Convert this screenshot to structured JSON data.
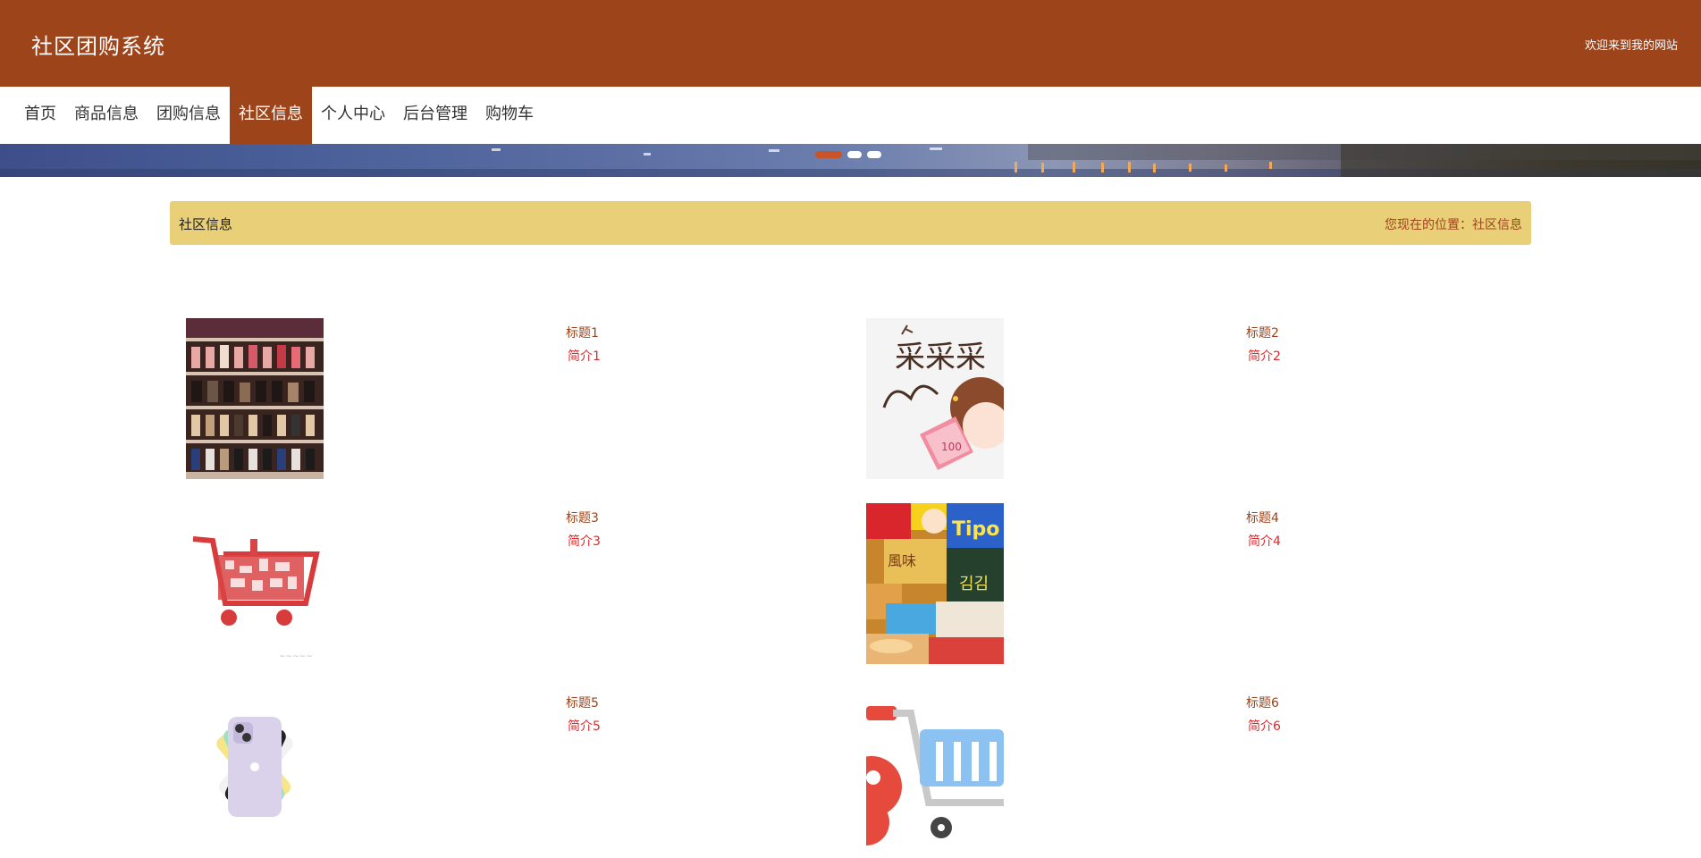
{
  "header": {
    "site_title": "社区团购系统",
    "welcome_text": "欢迎来到我的网站"
  },
  "nav": {
    "items": [
      {
        "label": "首页"
      },
      {
        "label": "商品信息"
      },
      {
        "label": "团购信息"
      },
      {
        "label": "社区信息",
        "active": true
      },
      {
        "label": "个人中心"
      },
      {
        "label": "后台管理"
      },
      {
        "label": "购物车"
      }
    ]
  },
  "banner": {
    "slide_count": 3,
    "active_slide": 1
  },
  "breadcrumb": {
    "section_title": "社区信息",
    "location_prefix": "您现在的位置：",
    "location_current": "社区信息"
  },
  "community_list": {
    "items": [
      {
        "title": "标题1",
        "desc": "简介1",
        "image": "shoe-rack-photo"
      },
      {
        "title": "标题2",
        "desc": "简介2",
        "image": "cartoon-girl-money-illustration"
      },
      {
        "title": "标题3",
        "desc": "简介3",
        "image": "shopping-cart-sketch"
      },
      {
        "title": "标题4",
        "desc": "简介4",
        "image": "snacks-pile-photo"
      },
      {
        "title": "标题5",
        "desc": "简介5",
        "image": "phone-colors-fan"
      },
      {
        "title": "标题6",
        "desc": "简介6",
        "image": "cartoon-shopping-cart"
      }
    ]
  },
  "colors": {
    "brand": "#9e441b",
    "breadcrumb_bg": "#e8cf78",
    "desc_text": "#e0282a",
    "active_dot": "#c9542a"
  }
}
